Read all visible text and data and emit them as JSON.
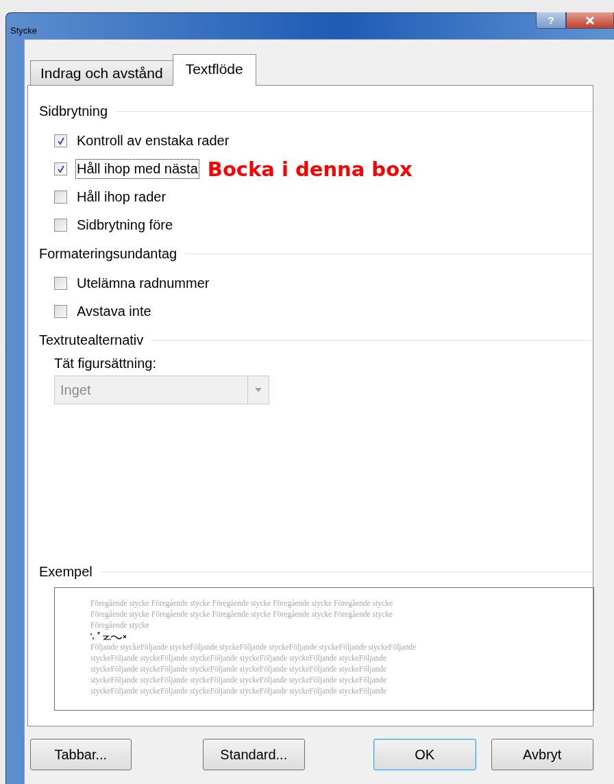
{
  "window": {
    "title": "Stycke",
    "help": "?"
  },
  "tabs": [
    {
      "label": "Indrag och avstånd",
      "selected": false
    },
    {
      "label": "Textflöde",
      "selected": true
    }
  ],
  "sections": [
    {
      "title": "Sidbrytning",
      "items": [
        {
          "label": "Kontroll av enstaka rader",
          "checked": true,
          "focused": false
        },
        {
          "label": "Håll ihop med nästa",
          "checked": true,
          "focused": true,
          "annotation": "Bocka i denna box"
        },
        {
          "label": "Håll ihop rader",
          "checked": false,
          "focused": false
        },
        {
          "label": "Sidbrytning före",
          "checked": false,
          "focused": false
        }
      ]
    },
    {
      "title": "Formateringsundantag",
      "items": [
        {
          "label": "Utelämna radnummer",
          "checked": false,
          "focused": false
        },
        {
          "label": "Avstava inte",
          "checked": false,
          "focused": false
        }
      ]
    },
    {
      "title": "Textrutealternativ",
      "dropdown": {
        "label": "Tät figursättning:",
        "value": "Inget",
        "disabled": true
      }
    }
  ],
  "preview": {
    "title": "Exempel",
    "previous_lines": [
      "Föregående stycke Föregående stycke Föregående stycke Föregående stycke Föregående stycke",
      "Föregående stycke Föregående stycke Föregående stycke Föregående stycke Föregående stycke",
      "Föregående stycke"
    ],
    "following_lines": [
      "Följande styckeFöljande styckeFöljande styckeFöljande styckeFöljande styckeFöljande styckeFöljande",
      "styckeFöljande styckeFöljande styckeFöljande styckeFöljande styckeFöljande styckeFöljande",
      "styckeFöljande styckeFöljande styckeFöljande styckeFöljande styckeFöljande styckeFöljande",
      "styckeFöljande styckeFöljande styckeFöljande styckeFöljande styckeFöljande styckeFöljande",
      "styckeFöljande styckeFöljande styckeFöljande styckeFöljande styckeFöljande styckeFöljande"
    ]
  },
  "buttons": [
    {
      "label": "Tabbar...",
      "default": false
    },
    {
      "label": "Standard...",
      "default": false
    },
    {
      "label": "OK",
      "default": true
    },
    {
      "label": "Avbryt",
      "default": false
    }
  ]
}
